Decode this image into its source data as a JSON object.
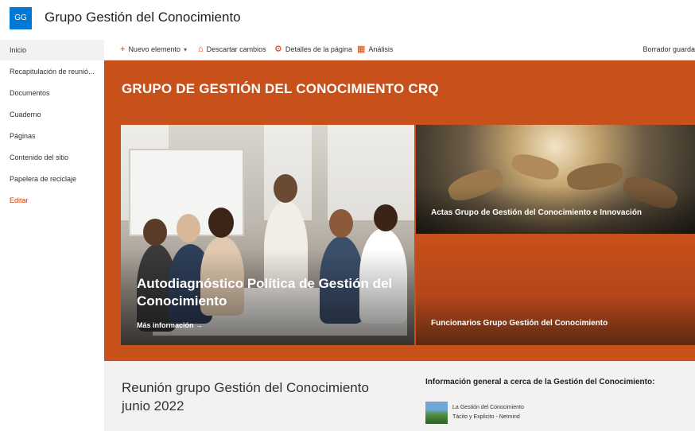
{
  "site": {
    "logo_initials": "GG",
    "title": "Grupo Gestión del Conocimiento"
  },
  "left_nav": {
    "items": [
      {
        "label": "Inicio",
        "active": true
      },
      {
        "label": "Recapitulación de reunió..."
      },
      {
        "label": "Documentos"
      },
      {
        "label": "Cuaderno"
      },
      {
        "label": "Páginas"
      },
      {
        "label": "Contenido del sitio"
      },
      {
        "label": "Papelera de reciclaje"
      },
      {
        "label": "Editar"
      }
    ]
  },
  "command_bar": {
    "new_item": "Nuevo elemento",
    "discard": "Descartar cambios",
    "page_details": "Detalles de la página",
    "analytics": "Análisis",
    "status": "Borrador guarda"
  },
  "hero": {
    "band_title": "GRUPO DE GESTIÓN DEL CONOCIMIENTO CRQ",
    "main_tile_title": "Autodiagnóstico Política de Gestión del Conocimiento",
    "main_tile_link": "Más información →",
    "top_tile_title": "Actas Grupo de Gestión del Conocimiento e Innovación",
    "bottom_tile_title": "Funcionarios Grupo Gestión del Conocimiento"
  },
  "lower_section": {
    "meeting_title": "Reunión grupo Gestión del Conocimiento junio 2022",
    "info_heading": "Información general a cerca de la Gestión del Conocimiento:",
    "info_item": {
      "line1": "La Gestión del Conocimiento",
      "line2": "Tácito y Explicito - Netmind"
    }
  },
  "colors": {
    "brand_blue": "#0078d4",
    "accent_orange": "#c8501a",
    "edit_link": "#d83b01"
  },
  "icons": {
    "new_item": "plus-icon",
    "discard": "discard-icon",
    "page_details": "gear-icon",
    "analytics": "analytics-icon"
  }
}
